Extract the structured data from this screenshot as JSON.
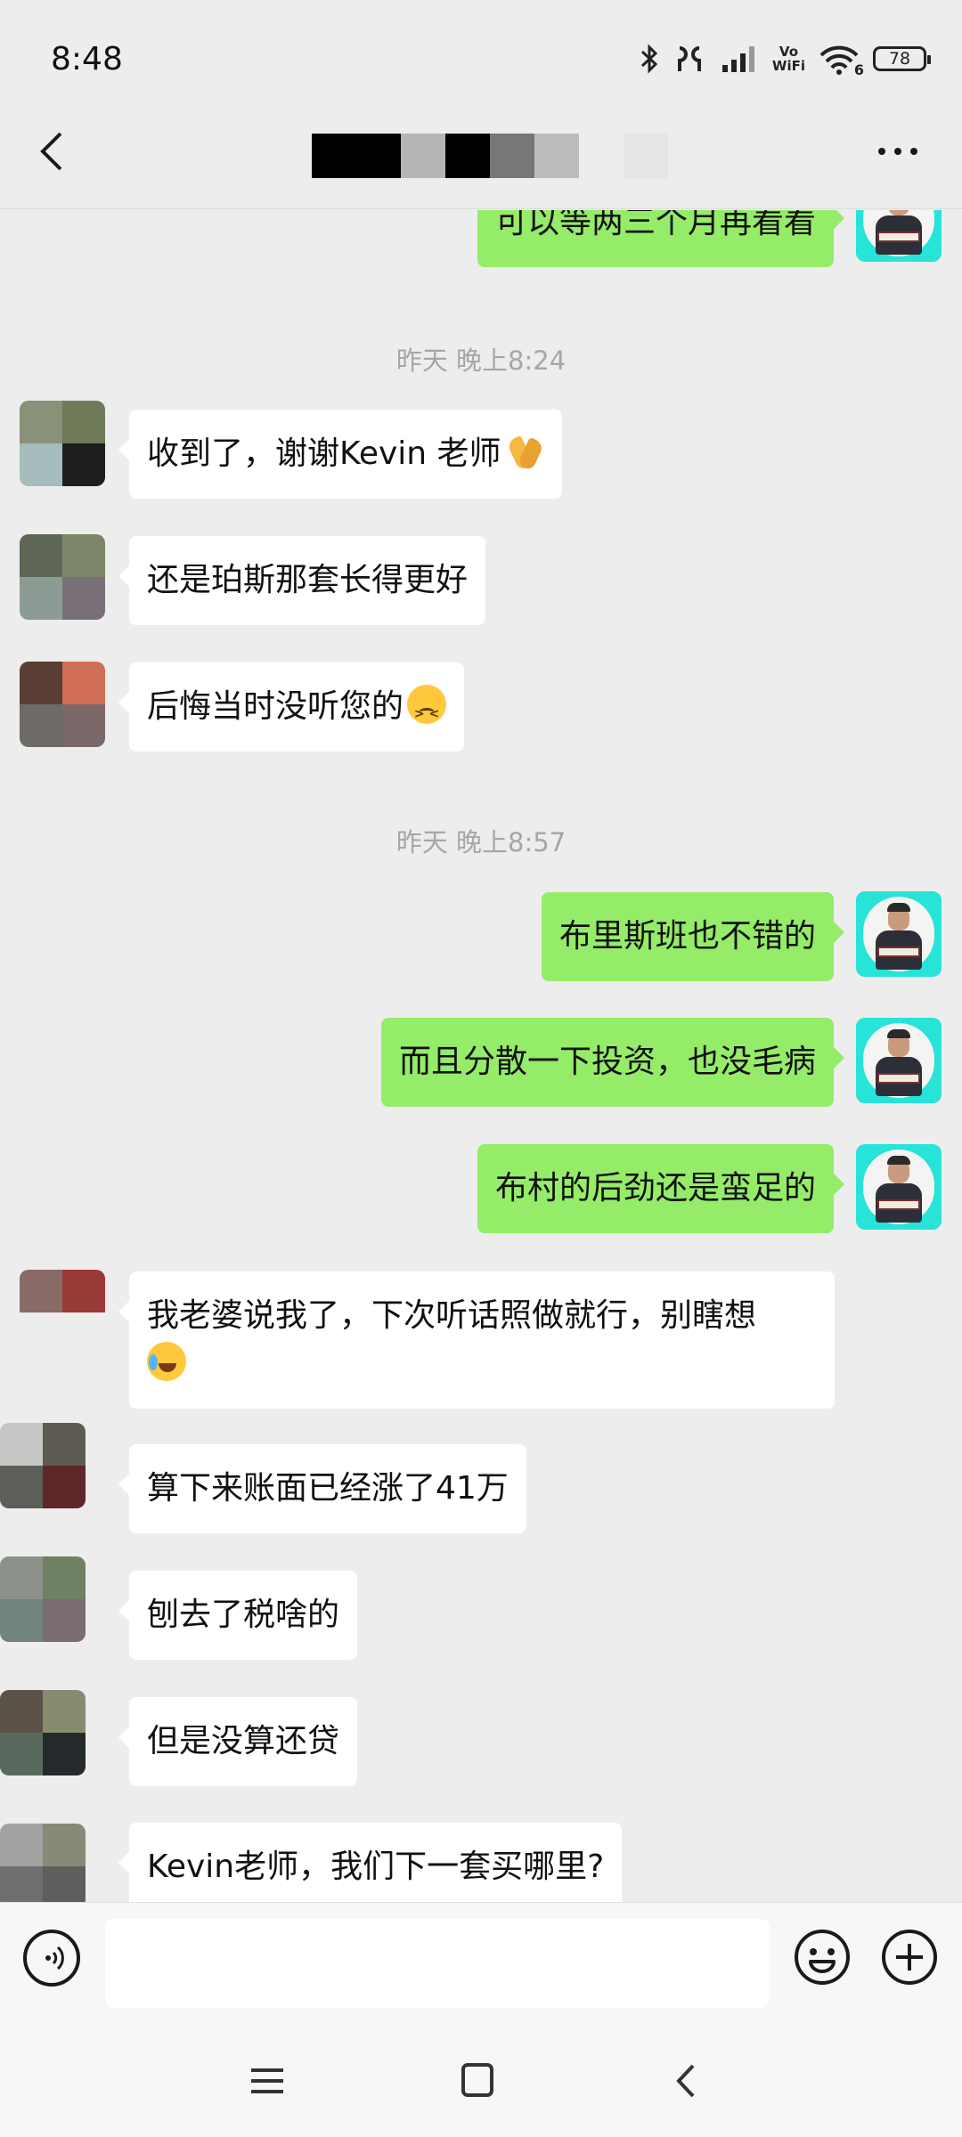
{
  "status_bar": {
    "time": "8:48",
    "wifi_label_top": "Vo",
    "wifi_label_bottom": "WiFi",
    "wifi_sub": "6",
    "battery": "78",
    "icons": [
      "bluetooth-icon",
      "earbuds-icon",
      "signal-icon",
      "vowifi-icon",
      "wifi-icon",
      "battery-icon"
    ]
  },
  "title_bar": {
    "back_icon": "back-arrow-icon",
    "title_obscured": true,
    "more_icon": "more-dots-icon"
  },
  "messages": [
    {
      "side": "right",
      "text": "可以等两三个月再看看"
    },
    {
      "type": "timestamp",
      "text": "昨天 晚上8:24"
    },
    {
      "side": "left",
      "text": "收到了，谢谢Kevin 老师",
      "emoji": "pray-emoji"
    },
    {
      "side": "left",
      "text": "还是珀斯那套长得更好"
    },
    {
      "side": "left",
      "text": "后悔当时没听您的",
      "emoji": "frown-emoji"
    },
    {
      "type": "timestamp",
      "text": "昨天 晚上8:57"
    },
    {
      "side": "right",
      "text": "布里斯班也不错的"
    },
    {
      "side": "right",
      "text": "而且分散一下投资，也没毛病"
    },
    {
      "side": "right",
      "text": "布村的后劲还是蛮足的"
    },
    {
      "side": "left",
      "text": "我老婆说我了，下次听话照做就行，别瞎想",
      "emoji": "laugh-cry-emoji"
    },
    {
      "side": "left",
      "text": "算下来账面已经涨了41万"
    },
    {
      "side": "left",
      "text": "刨去了税啥的"
    },
    {
      "side": "left",
      "text": "但是没算还贷"
    },
    {
      "side": "left",
      "text": "Kevin老师，我们下一套买哪里?"
    }
  ],
  "input_bar": {
    "voice_icon": "voice-icon",
    "placeholder": "",
    "emoji_icon": "emoji-icon",
    "plus_icon": "plus-icon"
  },
  "nav_bar": {
    "icons": [
      "menu-icon",
      "home-icon",
      "back-icon"
    ]
  },
  "colors": {
    "background": "#ededed",
    "bubble_sent": "#95ec69",
    "bubble_received": "#ffffff",
    "timestamp": "#a6a6a6",
    "avatar_me_bg": "#27e3d8"
  }
}
